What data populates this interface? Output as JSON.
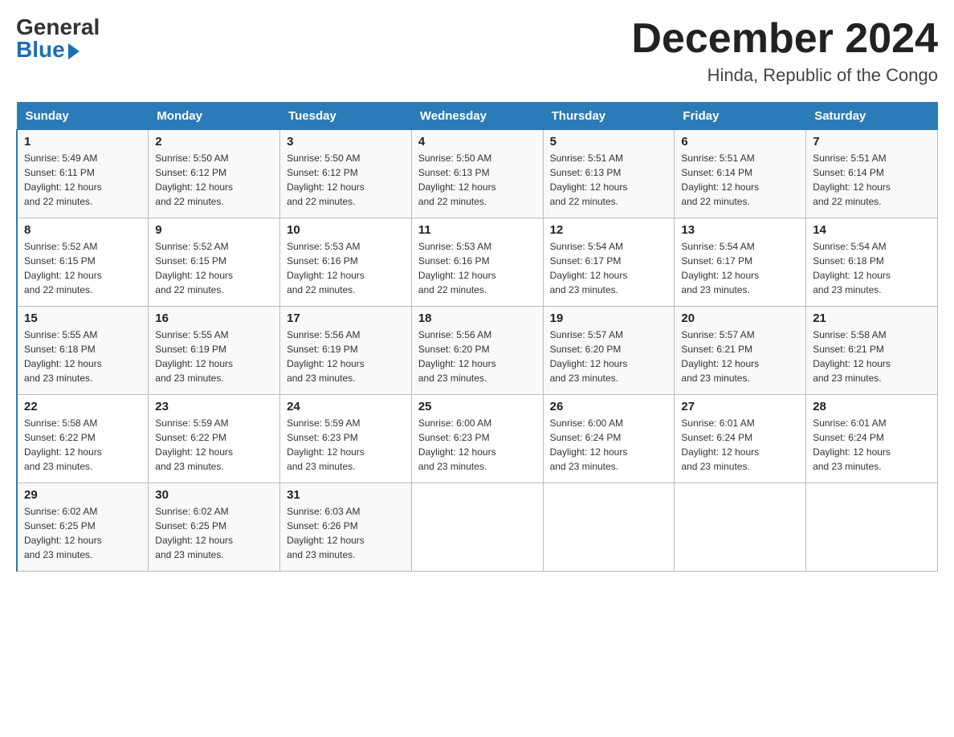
{
  "logo": {
    "general": "General",
    "blue": "Blue"
  },
  "title": {
    "month_year": "December 2024",
    "location": "Hinda, Republic of the Congo"
  },
  "headers": [
    "Sunday",
    "Monday",
    "Tuesday",
    "Wednesday",
    "Thursday",
    "Friday",
    "Saturday"
  ],
  "weeks": [
    [
      {
        "day": "1",
        "sunrise": "5:49 AM",
        "sunset": "6:11 PM",
        "daylight": "12 hours and 22 minutes."
      },
      {
        "day": "2",
        "sunrise": "5:50 AM",
        "sunset": "6:12 PM",
        "daylight": "12 hours and 22 minutes."
      },
      {
        "day": "3",
        "sunrise": "5:50 AM",
        "sunset": "6:12 PM",
        "daylight": "12 hours and 22 minutes."
      },
      {
        "day": "4",
        "sunrise": "5:50 AM",
        "sunset": "6:13 PM",
        "daylight": "12 hours and 22 minutes."
      },
      {
        "day": "5",
        "sunrise": "5:51 AM",
        "sunset": "6:13 PM",
        "daylight": "12 hours and 22 minutes."
      },
      {
        "day": "6",
        "sunrise": "5:51 AM",
        "sunset": "6:14 PM",
        "daylight": "12 hours and 22 minutes."
      },
      {
        "day": "7",
        "sunrise": "5:51 AM",
        "sunset": "6:14 PM",
        "daylight": "12 hours and 22 minutes."
      }
    ],
    [
      {
        "day": "8",
        "sunrise": "5:52 AM",
        "sunset": "6:15 PM",
        "daylight": "12 hours and 22 minutes."
      },
      {
        "day": "9",
        "sunrise": "5:52 AM",
        "sunset": "6:15 PM",
        "daylight": "12 hours and 22 minutes."
      },
      {
        "day": "10",
        "sunrise": "5:53 AM",
        "sunset": "6:16 PM",
        "daylight": "12 hours and 22 minutes."
      },
      {
        "day": "11",
        "sunrise": "5:53 AM",
        "sunset": "6:16 PM",
        "daylight": "12 hours and 22 minutes."
      },
      {
        "day": "12",
        "sunrise": "5:54 AM",
        "sunset": "6:17 PM",
        "daylight": "12 hours and 23 minutes."
      },
      {
        "day": "13",
        "sunrise": "5:54 AM",
        "sunset": "6:17 PM",
        "daylight": "12 hours and 23 minutes."
      },
      {
        "day": "14",
        "sunrise": "5:54 AM",
        "sunset": "6:18 PM",
        "daylight": "12 hours and 23 minutes."
      }
    ],
    [
      {
        "day": "15",
        "sunrise": "5:55 AM",
        "sunset": "6:18 PM",
        "daylight": "12 hours and 23 minutes."
      },
      {
        "day": "16",
        "sunrise": "5:55 AM",
        "sunset": "6:19 PM",
        "daylight": "12 hours and 23 minutes."
      },
      {
        "day": "17",
        "sunrise": "5:56 AM",
        "sunset": "6:19 PM",
        "daylight": "12 hours and 23 minutes."
      },
      {
        "day": "18",
        "sunrise": "5:56 AM",
        "sunset": "6:20 PM",
        "daylight": "12 hours and 23 minutes."
      },
      {
        "day": "19",
        "sunrise": "5:57 AM",
        "sunset": "6:20 PM",
        "daylight": "12 hours and 23 minutes."
      },
      {
        "day": "20",
        "sunrise": "5:57 AM",
        "sunset": "6:21 PM",
        "daylight": "12 hours and 23 minutes."
      },
      {
        "day": "21",
        "sunrise": "5:58 AM",
        "sunset": "6:21 PM",
        "daylight": "12 hours and 23 minutes."
      }
    ],
    [
      {
        "day": "22",
        "sunrise": "5:58 AM",
        "sunset": "6:22 PM",
        "daylight": "12 hours and 23 minutes."
      },
      {
        "day": "23",
        "sunrise": "5:59 AM",
        "sunset": "6:22 PM",
        "daylight": "12 hours and 23 minutes."
      },
      {
        "day": "24",
        "sunrise": "5:59 AM",
        "sunset": "6:23 PM",
        "daylight": "12 hours and 23 minutes."
      },
      {
        "day": "25",
        "sunrise": "6:00 AM",
        "sunset": "6:23 PM",
        "daylight": "12 hours and 23 minutes."
      },
      {
        "day": "26",
        "sunrise": "6:00 AM",
        "sunset": "6:24 PM",
        "daylight": "12 hours and 23 minutes."
      },
      {
        "day": "27",
        "sunrise": "6:01 AM",
        "sunset": "6:24 PM",
        "daylight": "12 hours and 23 minutes."
      },
      {
        "day": "28",
        "sunrise": "6:01 AM",
        "sunset": "6:24 PM",
        "daylight": "12 hours and 23 minutes."
      }
    ],
    [
      {
        "day": "29",
        "sunrise": "6:02 AM",
        "sunset": "6:25 PM",
        "daylight": "12 hours and 23 minutes."
      },
      {
        "day": "30",
        "sunrise": "6:02 AM",
        "sunset": "6:25 PM",
        "daylight": "12 hours and 23 minutes."
      },
      {
        "day": "31",
        "sunrise": "6:03 AM",
        "sunset": "6:26 PM",
        "daylight": "12 hours and 23 minutes."
      },
      null,
      null,
      null,
      null
    ]
  ],
  "labels": {
    "sunrise": "Sunrise:",
    "sunset": "Sunset:",
    "daylight": "Daylight:"
  }
}
